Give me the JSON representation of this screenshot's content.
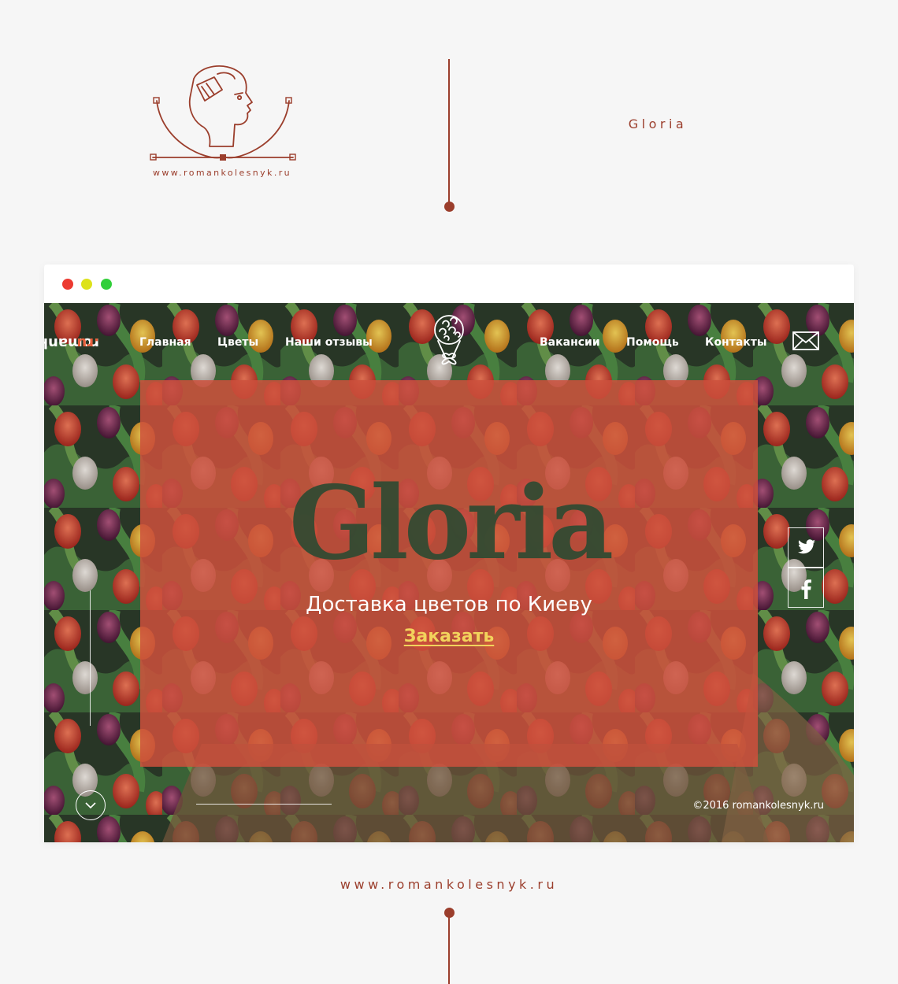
{
  "header": {
    "brand_url": "www.romankolesnyk.ru",
    "project_title": "Gloria"
  },
  "browser": {
    "window_dots": [
      "#ec3a31",
      "#dde21b",
      "#31cf3a"
    ]
  },
  "site": {
    "vertical_brand": {
      "name": "romankolesnyk",
      "ext": ".ru"
    },
    "nav_left": [
      "Главная",
      "Цветы",
      "Наши отзывы"
    ],
    "nav_right": [
      "Вакансии",
      "Помощь",
      "Контакты"
    ],
    "hero": {
      "title": "Gloria",
      "subtitle": "Доставка цветов по Киеву",
      "cta": "Заказать"
    },
    "copyright": "©2016 romankolesnyk.ru",
    "icons": {
      "logo": "flower-bouquet-icon",
      "mail": "envelope-icon",
      "twitter": "twitter-icon",
      "facebook": "facebook-icon",
      "scroll": "chevron-down-icon"
    }
  },
  "footer": {
    "url": "www.romankolesnyk.ru"
  },
  "colors": {
    "accent": "#9b3e2c",
    "overlay": "#cd503c",
    "cta": "#f2d35c",
    "background": "#f6f6f6"
  }
}
